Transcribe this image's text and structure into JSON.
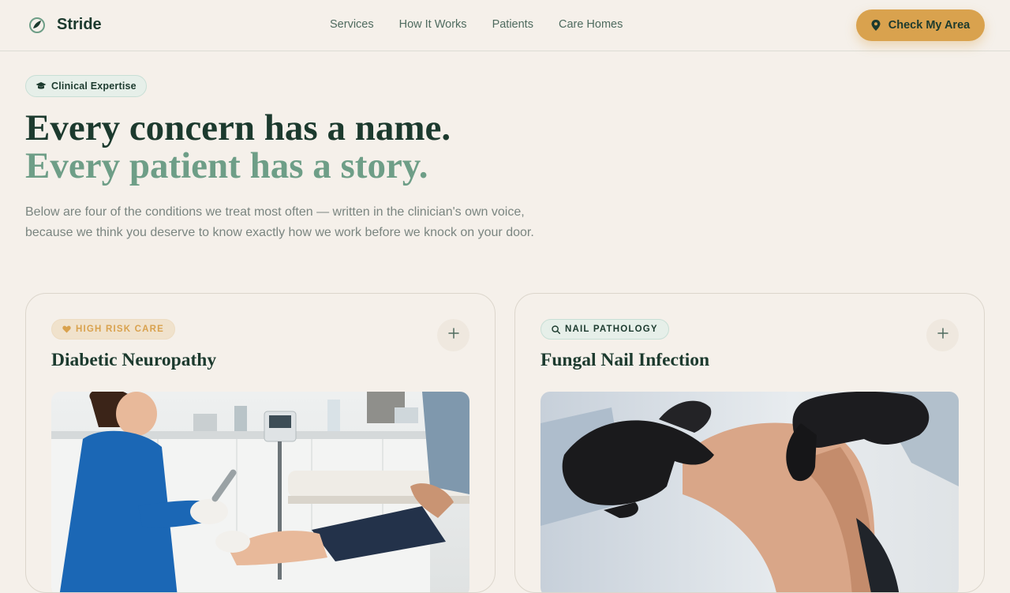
{
  "brand": {
    "name": "Stride"
  },
  "nav": {
    "items": [
      "Services",
      "How It Works",
      "Patients",
      "Care Homes"
    ]
  },
  "cta": {
    "label": "Check My Area",
    "icon": "map-pin-icon",
    "color": "#d9a24e"
  },
  "hero": {
    "badge": "Clinical Expertise",
    "badge_icon": "graduation-cap-icon",
    "headline_1": "Every concern has a name.",
    "headline_2": "Every patient has a story.",
    "lede_1": "Below are four of the conditions we treat most often — written in the clinician's own voice,",
    "lede_2": "because we think you deserve to know exactly how we work before we knock on your door."
  },
  "cards": [
    {
      "tag": "HIGH RISK CARE",
      "tag_icon": "heart-icon",
      "title": "Diabetic Neuropathy",
      "expand_icon": "plus-icon"
    },
    {
      "tag": "NAIL PATHOLOGY",
      "tag_icon": "search-icon",
      "title": "Fungal Nail Infection",
      "expand_icon": "plus-icon"
    }
  ],
  "colors": {
    "background": "#f5f0ea",
    "primary": "#1c3a2e",
    "accent_green": "#6e9e87",
    "accent_gold": "#d9a24e"
  }
}
